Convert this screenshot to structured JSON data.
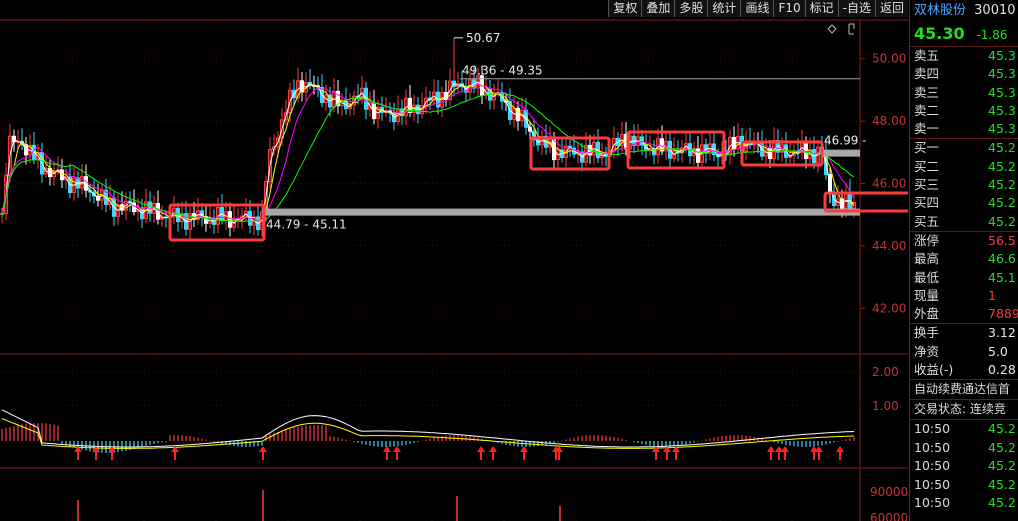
{
  "toolbar": {
    "buttons": [
      "复权",
      "叠加",
      "多股",
      "统计",
      "画线",
      "F10",
      "标记",
      "-自选",
      "返回"
    ]
  },
  "chart": {
    "price_axis": [
      "50.00",
      "48.00",
      "46.00",
      "44.00",
      "42.00"
    ],
    "macd_axis": [
      "2.00",
      "1.00"
    ],
    "vol_axis": [
      "90000",
      "60000"
    ],
    "annotations": {
      "high_label": "50.67",
      "range_top": "49.36 - 49.35",
      "range_bottom": "44.79 - 45.11",
      "right_level": "46.99"
    },
    "colors": {
      "up": "#ff3a3a",
      "down": "#22dd22",
      "ma5": "#ffffff",
      "ma10": "#ffff00",
      "ma20": "#ff00ff",
      "ma60": "#00ff00",
      "highlight_box": "#ff3a3a"
    }
  },
  "side": {
    "name": "双林股份",
    "code": "30010",
    "price": "45.30",
    "change": "-1.86",
    "change_extra": "-",
    "asks": [
      {
        "label": "卖五",
        "value": "45.3"
      },
      {
        "label": "卖四",
        "value": "45.3"
      },
      {
        "label": "卖三",
        "value": "45.3"
      },
      {
        "label": "卖二",
        "value": "45.3"
      },
      {
        "label": "卖一",
        "value": "45.3"
      }
    ],
    "bids": [
      {
        "label": "买一",
        "value": "45.2"
      },
      {
        "label": "买二",
        "value": "45.2"
      },
      {
        "label": "买三",
        "value": "45.2"
      },
      {
        "label": "买四",
        "value": "45.2"
      },
      {
        "label": "买五",
        "value": "45.2"
      }
    ],
    "stats": [
      {
        "label": "涨停",
        "value": "56.5"
      },
      {
        "label": "最高",
        "value": "46.6"
      },
      {
        "label": "最低",
        "value": "45.1"
      },
      {
        "label": "现量",
        "value": "1"
      },
      {
        "label": "外盘",
        "value": "7889"
      }
    ],
    "fin": [
      {
        "label": "换手",
        "value": "3.12"
      },
      {
        "label": "净资",
        "value": "5.0"
      },
      {
        "label": "收益(-)",
        "value": "0.28"
      }
    ],
    "notice": "自动续费通达信首",
    "trade_status": "交易状态: 连续竞",
    "ticks": [
      {
        "time": "10:50",
        "price": "45.2"
      },
      {
        "time": "10:50",
        "price": "45.2"
      },
      {
        "time": "10:50",
        "price": "45.2"
      },
      {
        "time": "10:50",
        "price": "45.2"
      },
      {
        "time": "10:50",
        "price": "45.2"
      }
    ]
  }
}
